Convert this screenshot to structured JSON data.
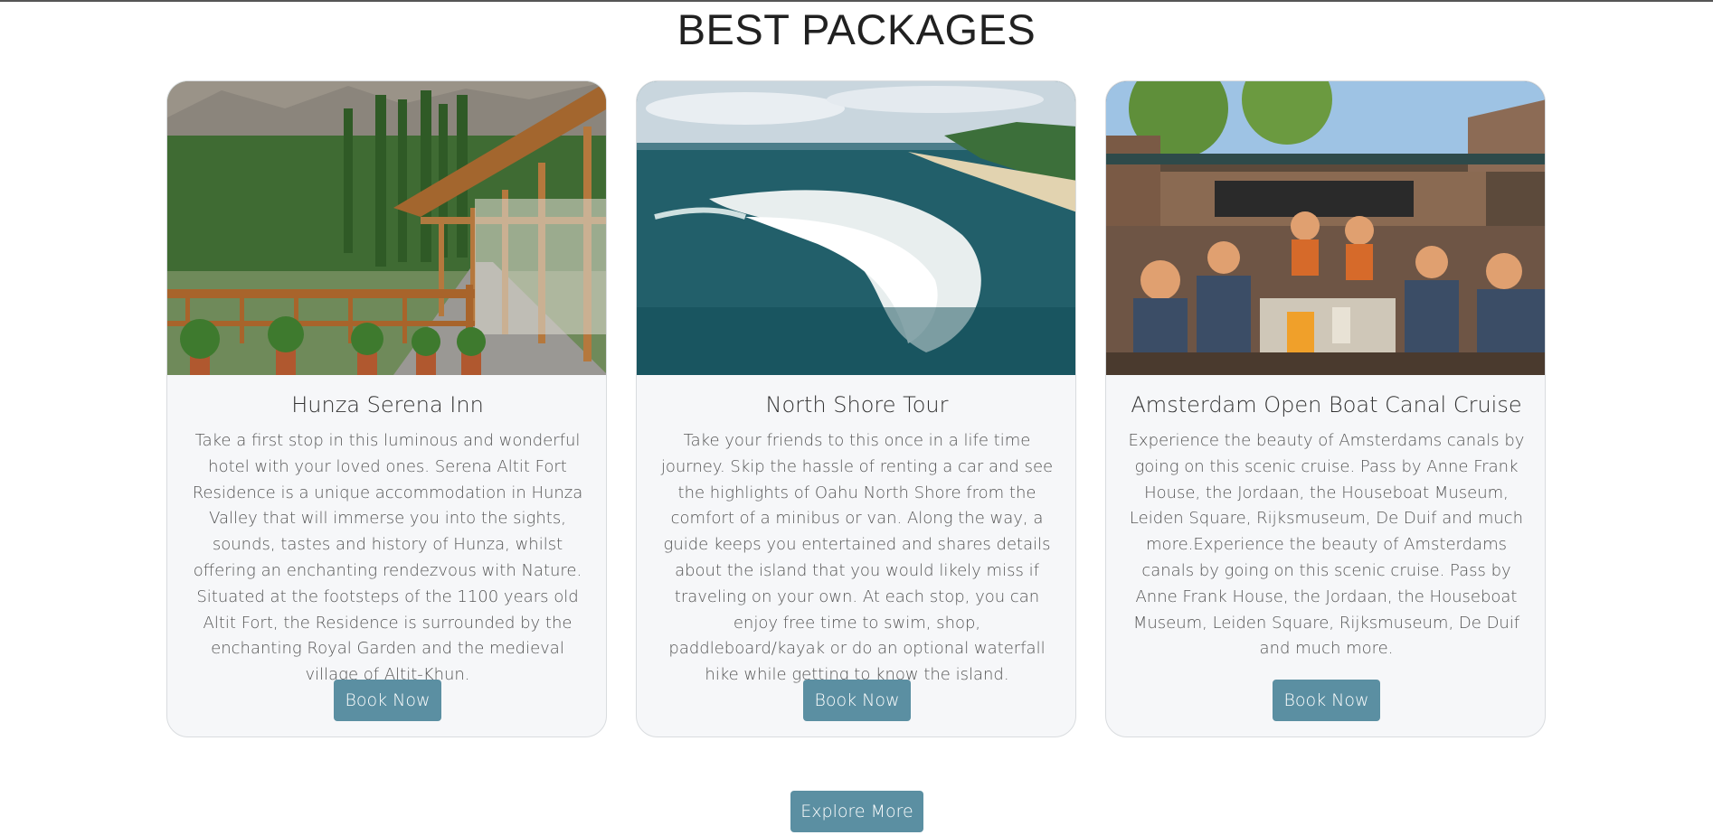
{
  "section": {
    "title": "BEST PACKAGES"
  },
  "colors": {
    "button": "#5b8fa2",
    "card_bg": "#f6f7f9",
    "card_border": "#d9dcdf"
  },
  "cards": [
    {
      "image_icon": "hotel-photo",
      "title": "Hunza Serena Inn",
      "description": "Take a first stop in this luminous and wonderful hotel with your loved ones. Serena Altit Fort Residence is a unique accommodation in Hunza Valley that will immerse you into the sights, sounds, tastes and history of Hunza, whilst offering an enchanting rendezvous with Nature. Situated at the footsteps of the 1100 years old Altit Fort, the Residence is surrounded by the enchanting Royal Garden and the medieval village of Altit-Khun.",
      "button_label": "Book Now"
    },
    {
      "image_icon": "ocean-wave-photo",
      "title": "North Shore Tour",
      "description": "Take your friends to this once in a life time journey. Skip the hassle of renting a car and see the highlights of Oahu North Shore from the comfort of a minibus or van. Along the way, a guide keeps you entertained and shares details about the island that you would likely miss if traveling on your own. At each stop, you can enjoy free time to swim, shop, paddleboard/kayak or do an optional waterfall hike while getting to know the island.",
      "button_label": "Book Now"
    },
    {
      "image_icon": "canal-boat-photo",
      "title": "Amsterdam Open Boat Canal Cruise",
      "description": "Experience the beauty of Amsterdams canals by going on this scenic cruise. Pass by Anne Frank House, the Jordaan, the Houseboat Museum, Leiden Square, Rijksmuseum, De Duif and much more.Experience the beauty of Amsterdams canals by going on this scenic cruise. Pass by Anne Frank House, the Jordaan, the Houseboat Museum, Leiden Square, Rijksmuseum, De Duif and much more.",
      "button_label": "Book Now"
    }
  ],
  "explore": {
    "label": "Explore More"
  }
}
